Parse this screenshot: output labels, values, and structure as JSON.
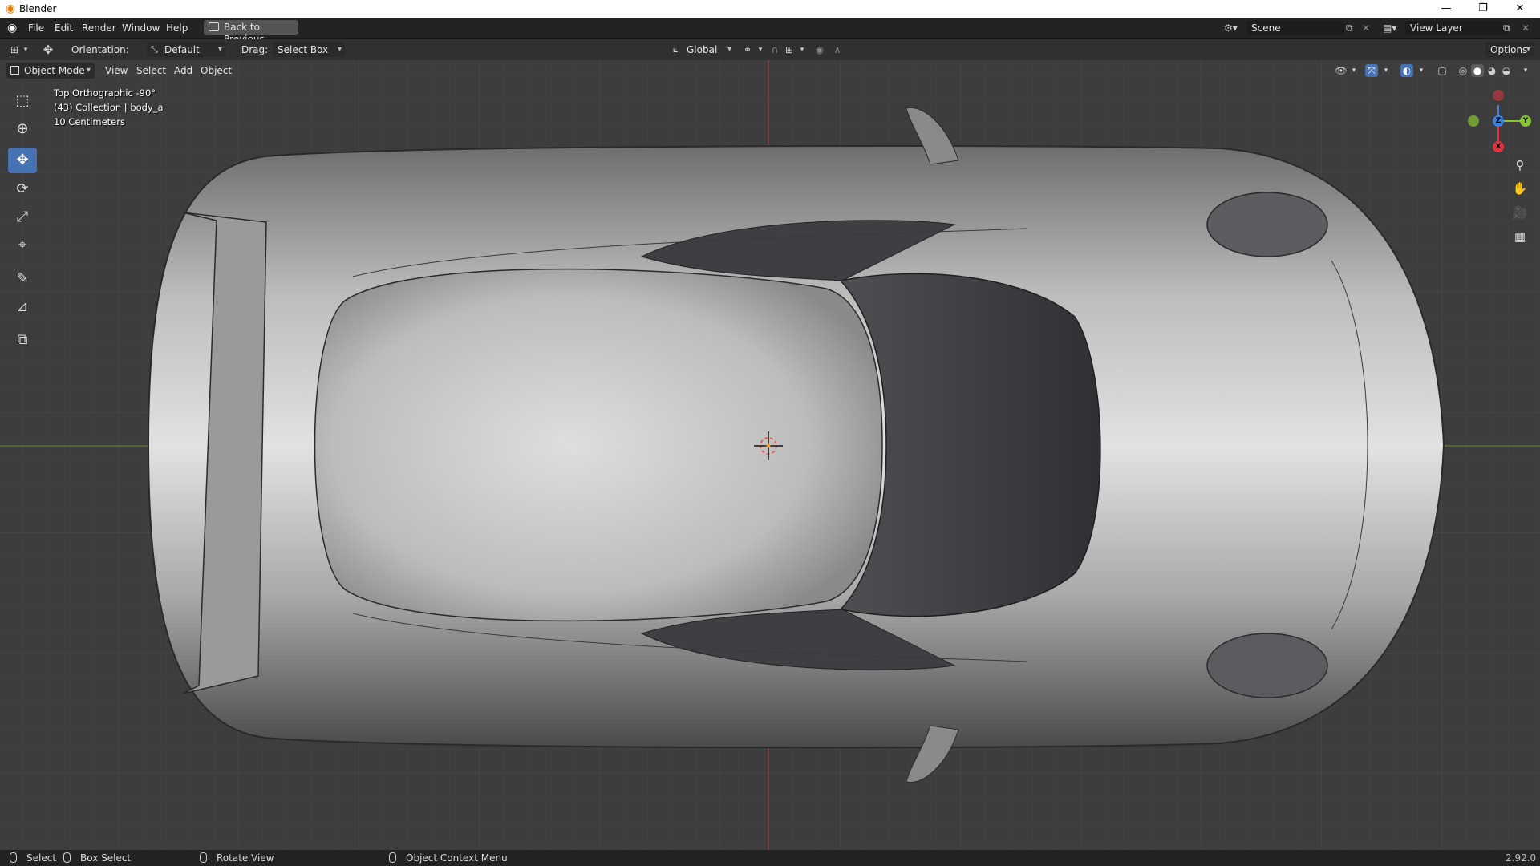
{
  "window": {
    "title": "Blender",
    "minimize": "—",
    "restore": "❐",
    "close": "✕"
  },
  "menubar": {
    "items": [
      "File",
      "Edit",
      "Render",
      "Window",
      "Help"
    ],
    "back_button": "Back to Previous",
    "scene_label": "Scene",
    "view_layer_label": "View Layer"
  },
  "tool_header": {
    "orientation_label": "Orientation:",
    "orientation_value": "Default",
    "drag_label": "Drag:",
    "drag_value": "Select Box",
    "transform_orientation": "Global",
    "options_label": "Options"
  },
  "viewport_header": {
    "mode": "Object Mode",
    "menus": [
      "View",
      "Select",
      "Add",
      "Object"
    ]
  },
  "viewport_overlay": {
    "view_name": "Top Orthographic -90°",
    "collection": "(43) Collection | body_a",
    "grid_scale": "10 Centimeters"
  },
  "toolbar": {
    "tools": [
      {
        "name": "select-box-tool",
        "icon": "⬚",
        "active": false
      },
      {
        "name": "cursor-tool",
        "icon": "⊕",
        "active": false
      },
      {
        "name": "move-tool",
        "icon": "✥",
        "active": true
      },
      {
        "name": "rotate-tool",
        "icon": "⟳",
        "active": false
      },
      {
        "name": "scale-tool",
        "icon": "⤢",
        "active": false
      },
      {
        "name": "transform-tool",
        "icon": "⌖",
        "active": false
      },
      {
        "name": "annotate-tool",
        "icon": "✎",
        "active": false
      },
      {
        "name": "measure-tool",
        "icon": "📐",
        "active": false
      },
      {
        "name": "add-cube-tool",
        "icon": "⧉",
        "active": false
      }
    ]
  },
  "gizmo": {
    "axis_z": "Z",
    "axis_y": "Y",
    "axis_x": "X",
    "colors": {
      "x": "#e0333e",
      "y": "#8bc535",
      "z": "#3b82e3"
    }
  },
  "statusbar": {
    "select": "Select",
    "box_select": "Box Select",
    "rotate_view": "Rotate View",
    "context_menu": "Object Context Menu",
    "version": "2.92.0"
  },
  "colors": {
    "accent": "#4772b3",
    "viewport_bg": "#3d3d3d",
    "x_axis_line": "#b33a3a",
    "y_axis_line": "#6b8e23"
  }
}
